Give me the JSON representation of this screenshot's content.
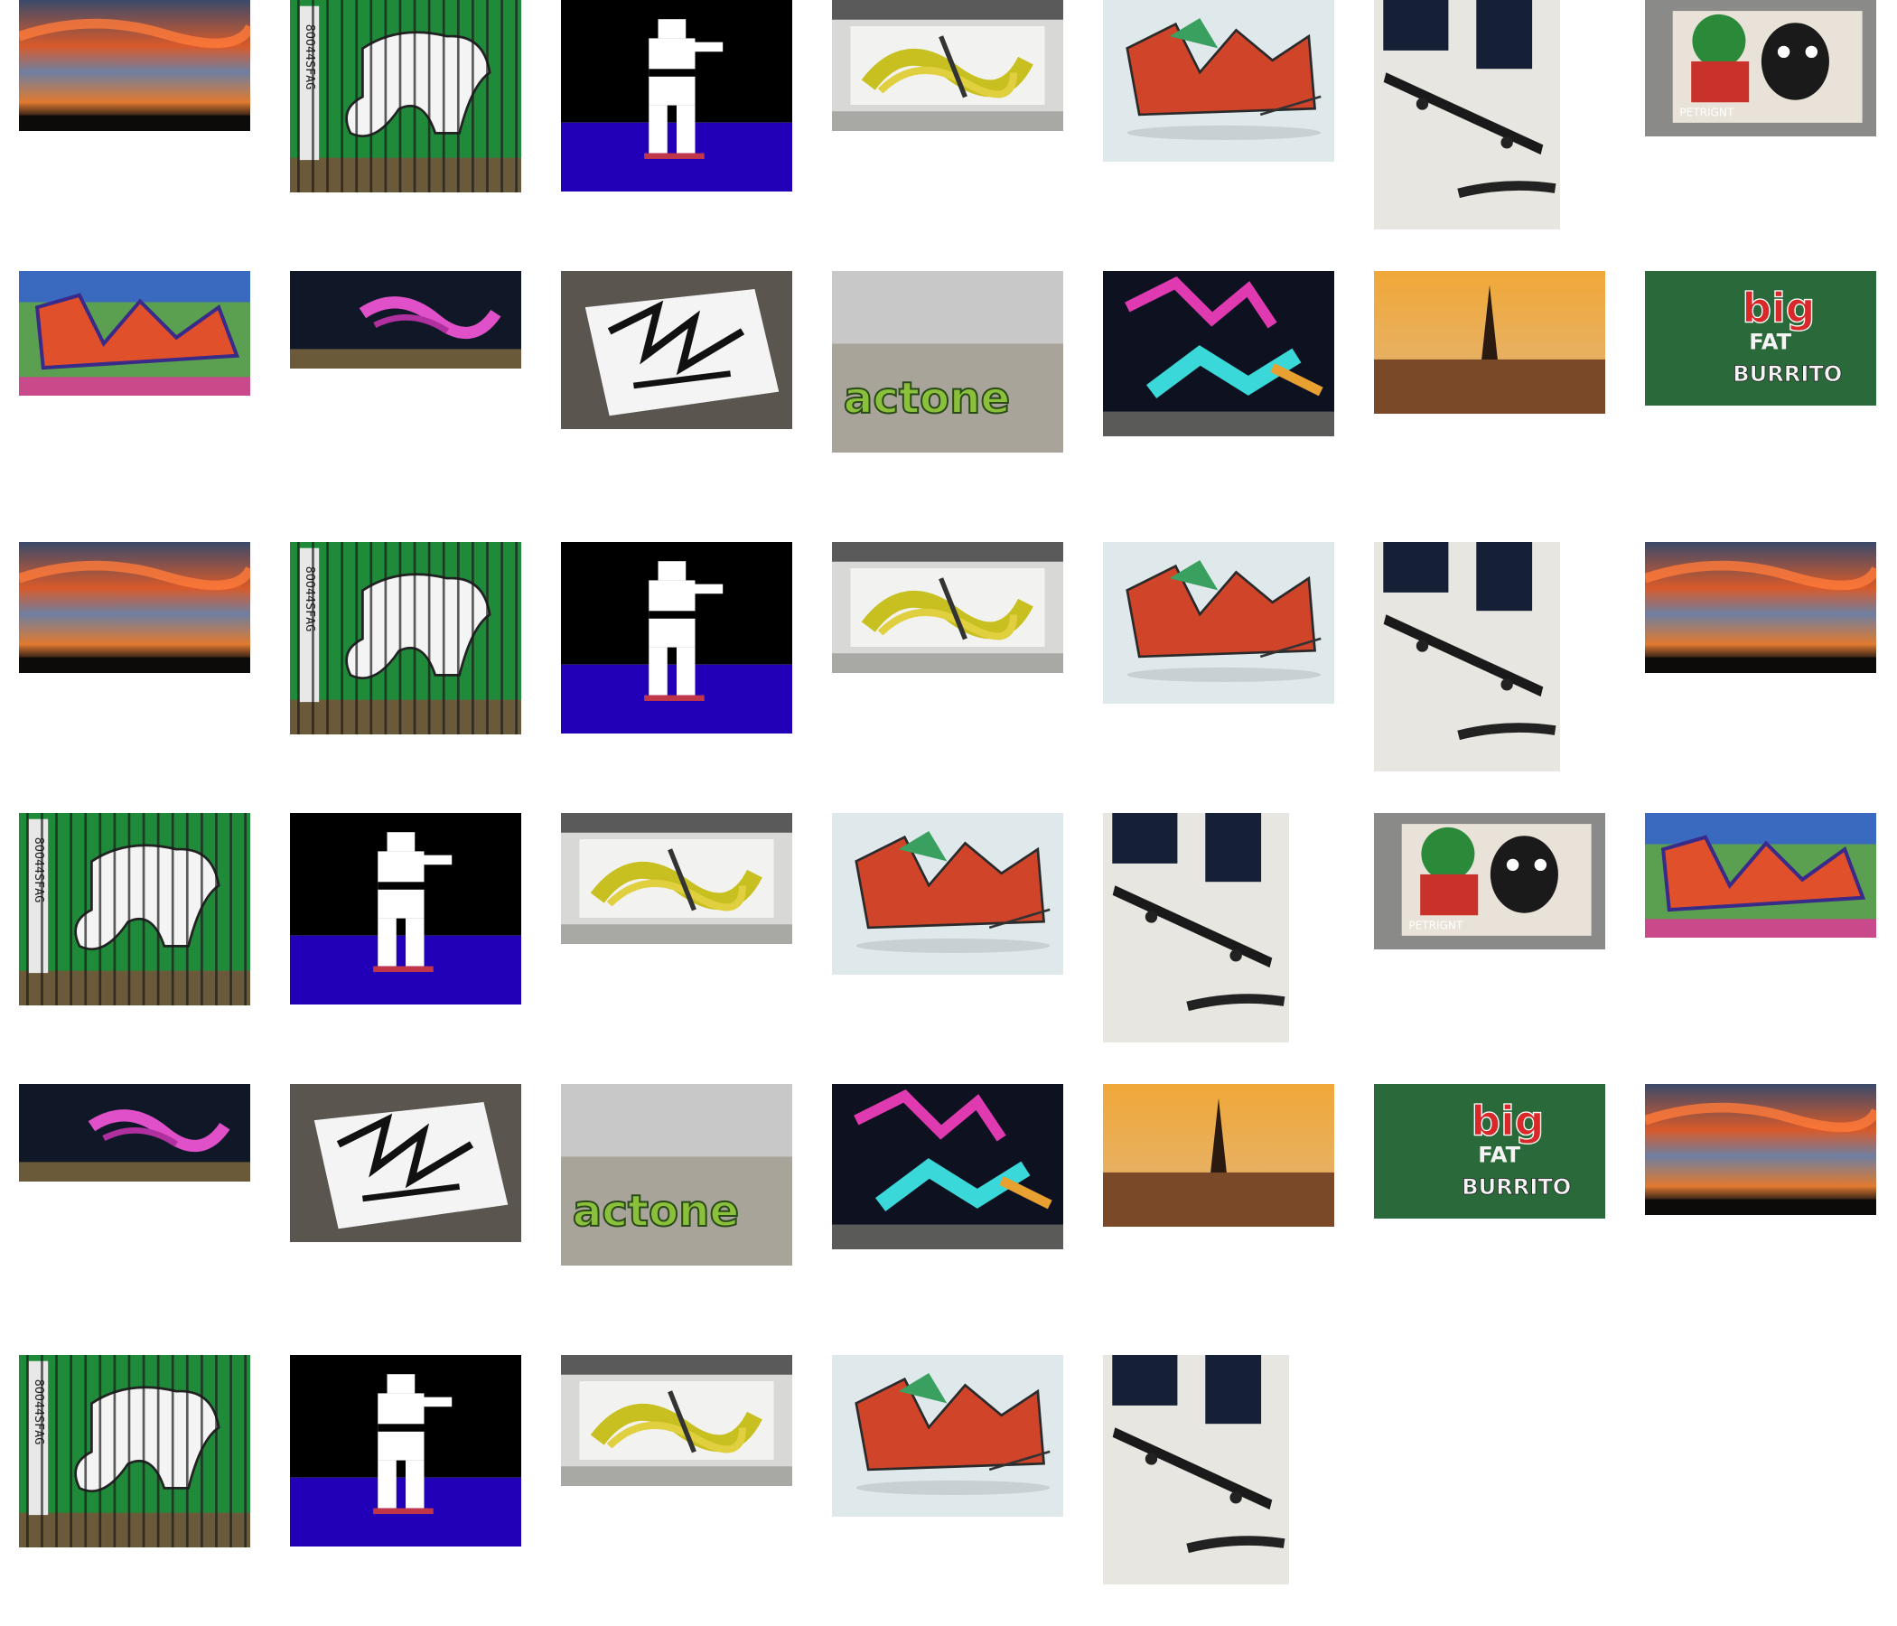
{
  "gallery": {
    "rows": [
      [
        "sunset",
        "horse-fence",
        "karate-pixel",
        "yellow-3d-wall",
        "red-3d-tag",
        "skateboard",
        "burger-wall"
      ],
      [
        "wildstyle-red",
        "pink-tag-wall",
        "black-sticker-tag",
        "actone-wall",
        "cyan-pink-wall",
        "paris-eiffel",
        "big-fat-burrito"
      ],
      [
        "sunset",
        "horse-fence",
        "karate-pixel",
        "yellow-3d-wall",
        "red-3d-tag",
        "skateboard",
        "sunset"
      ],
      [
        "horse-fence",
        "karate-pixel",
        "yellow-3d-wall",
        "red-3d-tag",
        "skateboard",
        "burger-wall",
        "wildstyle-red"
      ],
      [
        "pink-tag-wall",
        "black-sticker-tag",
        "actone-wall",
        "cyan-pink-wall",
        "paris-eiffel",
        "big-fat-burrito",
        "sunset"
      ],
      [
        "horse-fence",
        "karate-pixel",
        "yellow-3d-wall",
        "red-3d-tag",
        "skateboard"
      ]
    ],
    "texts": {
      "horse_fence_code": "8OO44SFAG",
      "actone_tag": "actone",
      "burrito_big": "big",
      "burrito_fat": "FAT",
      "burrito_name": "BURRITO",
      "burger_wall_caption": "PETRIGNT"
    }
  }
}
